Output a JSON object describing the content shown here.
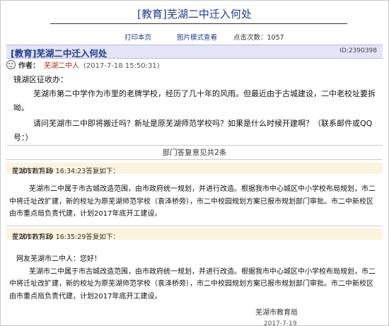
{
  "page": {
    "title": "[教育]芜湖二中迁入何处"
  },
  "toolbar": {
    "print_label": "打印本页",
    "image_mode_label": "图片模式查看",
    "click_count_label": "点击次数：",
    "click_count_value": "1057"
  },
  "post": {
    "title": "[教育]芜湖二中迁入何处",
    "id": "ID:2390398",
    "author_label": "作者：",
    "author_name": "芜湖二中人",
    "timestamp": "(2017-7-18 15:50:31)",
    "addressee": "镜湖区征收办：",
    "paragraph1": "芜湖市第二中学作为市里的老牌学校，经历了几十年的风雨。但最近由于古城建设，二中老校址要拆呦。",
    "paragraph2": "请问芜湖市二中即将搬迁吗？新址是原芜湖师范学校吗？如果是什么时候开建啊？（联系邮件或QQ号：）"
  },
  "replies_label": "部门答复意见共2条",
  "replies": [
    {
      "org": "芜湖市教育局",
      "meta": "在2017-7-19 16:34:23答复如下：",
      "greeting": "",
      "body": "芜湖市二中属于市古城改造范围，由市政府统一规划，并进行改造。根据我市中心城区中小学校布局规划，市二中将迁址改扩建，新的校址为原芜湖师范学校（袁泽桥旁），市二中校园规划方案已报市规划部门审批。市二中新校区由市重点局负责代建，计划2017年底开工建设。",
      "signature": "",
      "date_partial": ""
    },
    {
      "org": "芜湖市教育局",
      "meta": "在2017-7-19 16:35:29答复如下：",
      "greeting": "网友芜湖市二中人：您好！",
      "body": "芜湖市二中属于市古城改造范围，由市政府统一规划，并进行改造。根据我市中心城区中小学校布局规划，市二中将迁址改扩建，新的校址为原芜湖师范学校（袁泽桥旁），市二中校园规划方案已报市规划部门审批。市二中新校区由市重点局负责代建，计划2017年底开工建设。",
      "signature": "芜湖市教育局",
      "date_partial": "2017-7-19"
    }
  ]
}
